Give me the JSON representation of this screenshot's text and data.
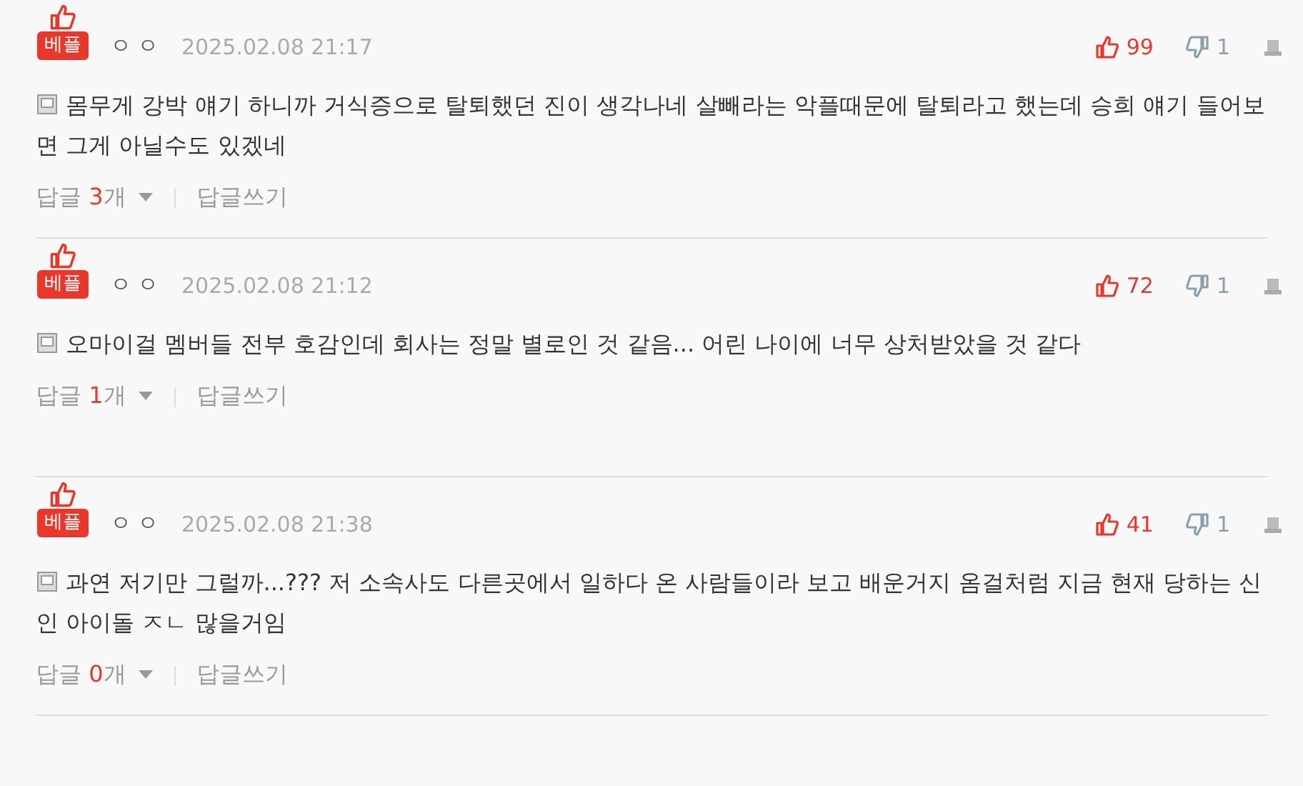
{
  "comments": [
    {
      "badge": "베플",
      "author": "ㅇㅇ",
      "date": "2025.02.08 21:17",
      "likes": "99",
      "dislikes": "1",
      "text": "몸무게 강박 얘기 하니까 거식증으로 탈퇴했던 진이 생각나네 살빼라는 악플때문에 탈퇴라고 했는데 승희 얘기 들어보면 그게 아닐수도 있겠네",
      "reply_prefix": "답글",
      "reply_count": "3",
      "reply_suffix": "개",
      "write_reply": "답글쓰기"
    },
    {
      "badge": "베플",
      "author": "ㅇㅇ",
      "date": "2025.02.08 21:12",
      "likes": "72",
      "dislikes": "1",
      "text": "오마이걸 멤버들 전부 호감인데 회사는 정말 별로인 것 같음... 어린 나이에 너무 상처받았을 것 같다",
      "reply_prefix": "답글",
      "reply_count": "1",
      "reply_suffix": "개",
      "write_reply": "답글쓰기"
    },
    {
      "badge": "베플",
      "author": "ㅇㅇ",
      "date": "2025.02.08 21:38",
      "likes": "41",
      "dislikes": "1",
      "text": "과연 저기만 그럴까...??? 저 소속사도 다른곳에서 일하다 온 사람들이라 보고 배운거지 옴걸처럼 지금 현재 당하는 신인 아이돌 ㅈㄴ 많을거임",
      "reply_prefix": "답글",
      "reply_count": "0",
      "reply_suffix": "개",
      "write_reply": "답글쓰기"
    }
  ]
}
